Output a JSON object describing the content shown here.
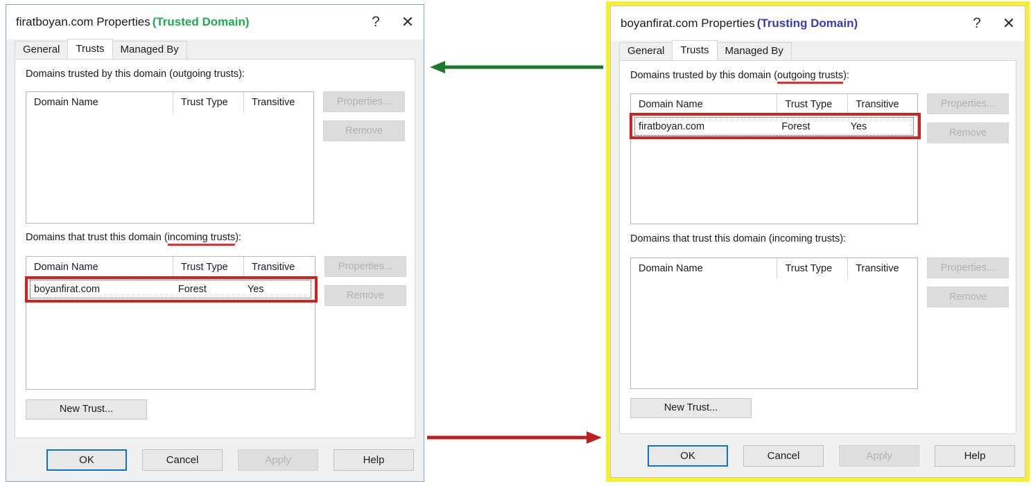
{
  "left_window": {
    "title": "firatboyan.com Properties",
    "title_tag": "(Trusted Domain)",
    "title_tag_color": "#1faa52",
    "help_icon": "?",
    "close_icon": "✕",
    "tabs": [
      {
        "label": "General",
        "active": false
      },
      {
        "label": "Trusts",
        "active": true
      },
      {
        "label": "Managed By",
        "active": false
      }
    ],
    "outgoing": {
      "label_plain": "Domains trusted by this domain (outgoing trusts):",
      "label_a": "Domains trusted by this domain (outgoing trusts):",
      "columns": [
        "Domain Name",
        "Trust Type",
        "Transitive"
      ],
      "rows": [],
      "properties_button": "Properties...",
      "remove_button": "Remove"
    },
    "incoming": {
      "label_a": "Domains that trust this domain (",
      "label_underlined": "incoming trusts",
      "label_b": "):",
      "columns": [
        "Domain Name",
        "Trust Type",
        "Transitive"
      ],
      "rows": [
        {
          "name": "boyanfirat.com",
          "type": "Forest",
          "transitive": "Yes",
          "highlighted": true
        }
      ],
      "properties_button": "Properties...",
      "remove_button": "Remove"
    },
    "new_trust_button": "New Trust...",
    "footer": {
      "ok": "OK",
      "cancel": "Cancel",
      "apply": "Apply",
      "help": "Help"
    }
  },
  "right_window": {
    "title": "boyanfirat.com Properties",
    "title_tag": "(Trusting Domain)",
    "title_tag_color": "#3a3ab5",
    "help_icon": "?",
    "close_icon": "✕",
    "border_color": "#f7f032",
    "tabs": [
      {
        "label": "General",
        "active": false
      },
      {
        "label": "Trusts",
        "active": true
      },
      {
        "label": "Managed By",
        "active": false
      }
    ],
    "outgoing": {
      "label_a": "Domains trusted by this domain (",
      "label_underlined": "outgoing trusts",
      "label_b": "):",
      "columns": [
        "Domain Name",
        "Trust Type",
        "Transitive"
      ],
      "rows": [
        {
          "name": "firatboyan.com",
          "type": "Forest",
          "transitive": "Yes",
          "highlighted": true
        }
      ],
      "properties_button": "Properties...",
      "remove_button": "Remove"
    },
    "incoming": {
      "label_plain": "Domains that trust this domain (incoming trusts):",
      "columns": [
        "Domain Name",
        "Trust Type",
        "Transitive"
      ],
      "rows": [],
      "properties_button": "Properties...",
      "remove_button": "Remove"
    },
    "new_trust_button": "New Trust...",
    "footer": {
      "ok": "OK",
      "cancel": "Cancel",
      "apply": "Apply",
      "help": "Help"
    }
  },
  "annotations": {
    "arrow_top": {
      "name": "green-left-arrow",
      "color": "#1b7a2a",
      "direction": "left"
    },
    "arrow_bottom": {
      "name": "red-right-arrow",
      "color": "#c01f1f",
      "direction": "right"
    },
    "highlight_color": "#d62020"
  }
}
